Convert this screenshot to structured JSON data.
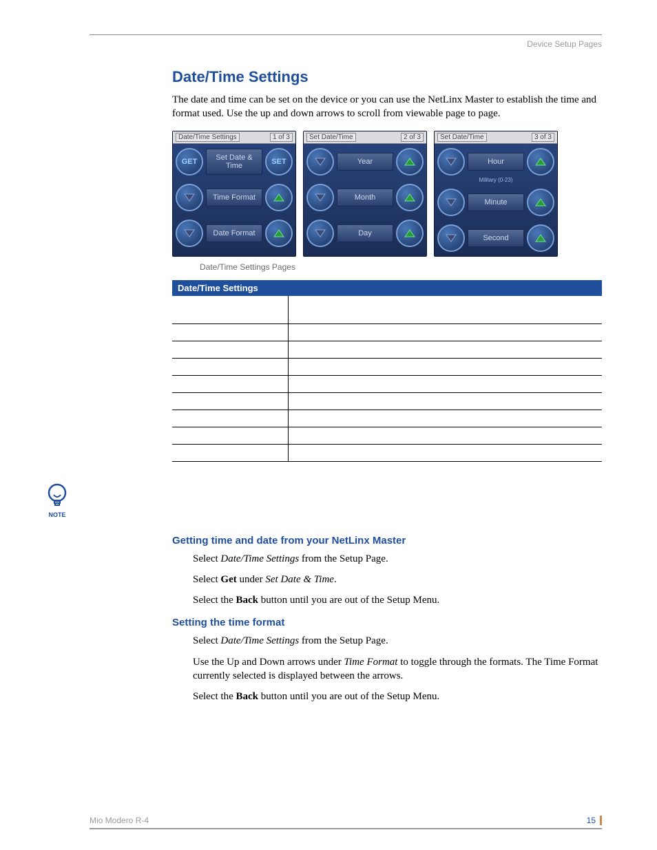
{
  "header": {
    "section": "Device Setup Pages"
  },
  "title": "Date/Time Settings",
  "intro": "The date and time can be set on the device or you can use the NetLinx Master to establish the time and format used. Use the up and down arrows to scroll from viewable page to page.",
  "panels": [
    {
      "title": "Date/Time Settings",
      "page": "1 of 3",
      "rows": [
        {
          "leftType": "text",
          "leftText": "GET",
          "label": "Set Date & Time",
          "rightType": "text",
          "rightText": "SET"
        },
        {
          "leftType": "down",
          "label": "Time Format",
          "rightType": "up"
        },
        {
          "leftType": "down",
          "label": "Date Format",
          "rightType": "up"
        }
      ]
    },
    {
      "title": "Set Date/Time",
      "page": "2 of 3",
      "rows": [
        {
          "leftType": "down",
          "label": "Year",
          "rightType": "up"
        },
        {
          "leftType": "down",
          "label": "Month",
          "rightType": "up"
        },
        {
          "leftType": "down",
          "label": "Day",
          "rightType": "up"
        }
      ]
    },
    {
      "title": "Set Date/Time",
      "page": "3 of 3",
      "rows": [
        {
          "leftType": "down",
          "label": "Hour",
          "sub": "Military (0-23)",
          "rightType": "up"
        },
        {
          "leftType": "down",
          "label": "Minute",
          "rightType": "up"
        },
        {
          "leftType": "down",
          "label": "Second",
          "rightType": "up"
        }
      ]
    }
  ],
  "caption": "Date/Time Settings Pages",
  "table": {
    "header": "Date/Time Settings",
    "rows": [
      {
        "tall": true
      },
      {
        "tall": false
      },
      {
        "tall": false
      },
      {
        "tall": false
      },
      {
        "tall": false
      },
      {
        "tall": false
      },
      {
        "tall": false
      },
      {
        "tall": false
      },
      {
        "tall": false
      }
    ]
  },
  "note": {
    "label": "NOTE"
  },
  "sections": [
    {
      "heading": "Getting time and date from your NetLinx Master",
      "steps": [
        {
          "pre": "Select ",
          "i1": "Date/Time Settings",
          "mid": " from the Setup Page."
        },
        {
          "pre": "Select ",
          "b": "Get",
          "mid": " under ",
          "i1": "Set Date & Time",
          "post": "."
        },
        {
          "pre": "Select the ",
          "b": "Back",
          "mid": " button until you are out of the Setup Menu."
        }
      ]
    },
    {
      "heading": "Setting the time format",
      "steps": [
        {
          "pre": "Select ",
          "i1": "Date/Time Settings",
          "mid": " from the Setup Page."
        },
        {
          "pre": "Use the Up and Down arrows under ",
          "i1": "Time Format",
          "mid": " to toggle through the formats. The Time Format currently selected is displayed between the arrows."
        },
        {
          "pre": "Select the ",
          "b": "Back",
          "mid": " button until you are out of the Setup Menu."
        }
      ]
    }
  ],
  "footer": {
    "product": "Mio Modero R-4",
    "page": "15"
  }
}
